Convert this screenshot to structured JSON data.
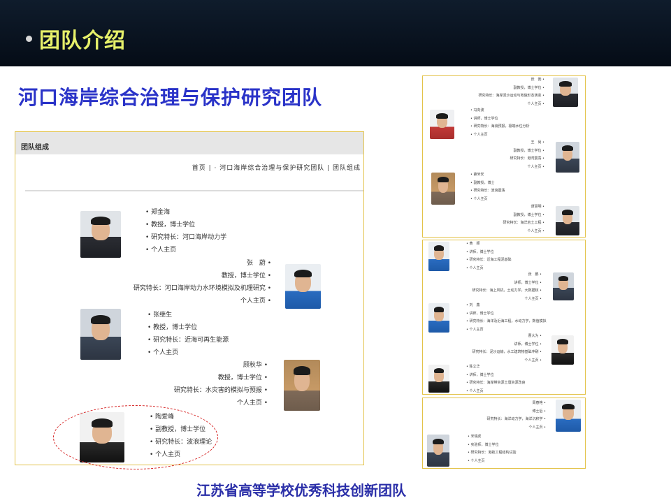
{
  "header": {
    "title": "团队介绍"
  },
  "headline": "河口海岸综合治理与保护研究团队",
  "footer": "江苏省高等学校优秀科技创新团队",
  "main": {
    "bar_title": "团队组成",
    "breadcrumb": "首页 | · 河口海岸综合治理与保护研究团队 | 团队组成",
    "members": [
      {
        "name": "郑金海",
        "title": "教授，博士学位",
        "field": "研究特长：河口海岸动力学",
        "link": "个人主页"
      },
      {
        "name": "张　蔚",
        "title": "教授，博士学位",
        "field": "研究特长：河口海岸动力水环境模拟及机理研究",
        "link": "个人主页"
      },
      {
        "name": "张继生",
        "title": "教授，博士学位",
        "field": "研究特长：近海可再生能源",
        "link": "个人主页"
      },
      {
        "name": "顾秋华",
        "title": "教授，博士学位",
        "field": "研究特长：水灾害的模拟与预报",
        "link": "个人主页"
      },
      {
        "name": "陶爱峰",
        "title": "副教授，博士学位",
        "field": "研究特长：波浪理论",
        "link": "个人主页"
      }
    ]
  },
  "thumb1": {
    "members": [
      {
        "name": "张　弛",
        "title": "副教授，博士学位",
        "field": "研究特长：海岸泥沙运动与地貌形态演变",
        "link": "个人主页"
      },
      {
        "name": "冯向波",
        "title": "讲师，博士学位",
        "field": "研究特长：海浪预报，极端水位分析",
        "link": "个人主页"
      },
      {
        "name": "王　尚",
        "title": "副教授，博士学位",
        "field": "研究特长：港湾震荡",
        "link": "个人主页"
      },
      {
        "name": "薛米安",
        "title": "副教授，博士",
        "field": "研究特长：波浪震荡",
        "link": "个人主页"
      },
      {
        "name": "谭慧明",
        "title": "副教授，博士学位",
        "field": "研究特长：海洋岩土工程",
        "link": "个人主页"
      }
    ]
  },
  "thumb2": {
    "members": [
      {
        "name": "黄　颖",
        "title": "讲师，博士学位",
        "field": "研究特长：近海工程泥基础",
        "link": "个人主页"
      },
      {
        "name": "张　鹏",
        "title": "讲师，博士学位",
        "field": "研究特长：海上风机，土动力学，大数据核",
        "link": "个人主页"
      },
      {
        "name": "刘　鑫",
        "title": "讲师，博士学位",
        "field": "研究特长：海洋及近海工程，水动力学，数值模拟",
        "link": "个人主页"
      },
      {
        "name": "曹大为",
        "title": "讲师，博士学位",
        "field": "研究特长：泥沙运输，水工建筑物基础冲刷",
        "link": "个人主页"
      },
      {
        "name": "陈立华",
        "title": "讲师，博士学位",
        "field": "研究特长：海岸带资源土壤资源改良",
        "link": "个人主页"
      }
    ]
  },
  "thumb3": {
    "members": [
      {
        "name": "周春艳",
        "title": "博士后",
        "field": "研究特长：海洋动力学，海洋沉积学",
        "link": "个人主页"
      },
      {
        "name": "宋瑞虎",
        "title": "实验师，博士学位",
        "field": "研究特长：港航工程结构试验",
        "link": "个人主页"
      }
    ]
  }
}
